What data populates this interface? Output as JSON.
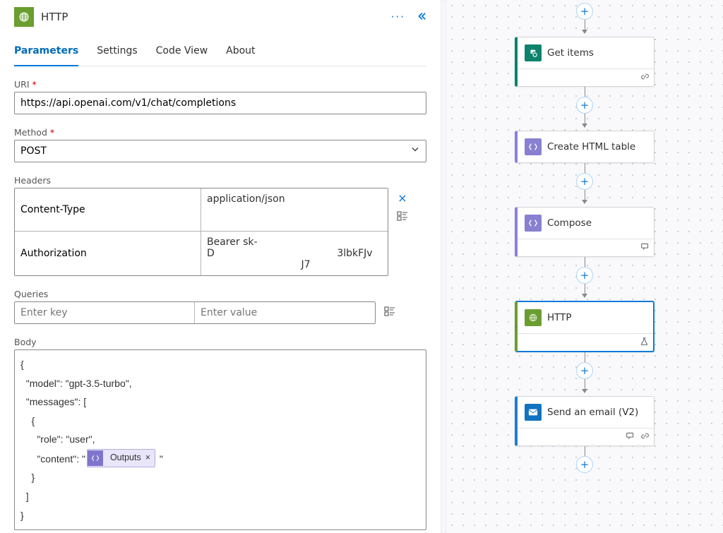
{
  "header": {
    "title": "HTTP"
  },
  "tabs": [
    "Parameters",
    "Settings",
    "Code View",
    "About"
  ],
  "active_tab": 0,
  "uri": {
    "label": "URI",
    "required": true,
    "value": "https://api.openai.com/v1/chat/completions"
  },
  "method": {
    "label": "Method",
    "required": true,
    "value": "POST"
  },
  "headers": {
    "label": "Headers",
    "rows": [
      {
        "key": "Content-Type",
        "value": "application/json"
      },
      {
        "key": "Authorization",
        "value": "Bearer sk-\nD                                       3lbkFJv\n                              J7"
      }
    ]
  },
  "queries": {
    "label": "Queries",
    "key_placeholder": "Enter key",
    "value_placeholder": "Enter value"
  },
  "body": {
    "label": "Body",
    "lines_pre": [
      "{",
      "  \"model\": \"gpt-3.5-turbo\",",
      "  \"messages\": [",
      "    {",
      "      \"role\": \"user\","
    ],
    "content_prefix": "      \"content\": \"",
    "token_label": "Outputs",
    "content_suffix": "\"",
    "lines_post": [
      "    }",
      "  ]",
      "}"
    ]
  },
  "flow": {
    "nodes": [
      {
        "title": "Get items",
        "accent": "c-getitems",
        "icon": "sharepoint",
        "footer": [
          "link"
        ]
      },
      {
        "title": "Create HTML table",
        "accent": "c-createtbl",
        "icon": "dataop",
        "footer": []
      },
      {
        "title": "Compose",
        "accent": "c-compose",
        "icon": "dataop",
        "footer": [
          "comment"
        ]
      },
      {
        "title": "HTTP",
        "accent": "c-http",
        "icon": "http",
        "footer": [
          "flask"
        ],
        "selected": true
      },
      {
        "title": "Send an email (V2)",
        "accent": "c-email",
        "icon": "email",
        "footer": [
          "comment",
          "link"
        ]
      }
    ]
  }
}
